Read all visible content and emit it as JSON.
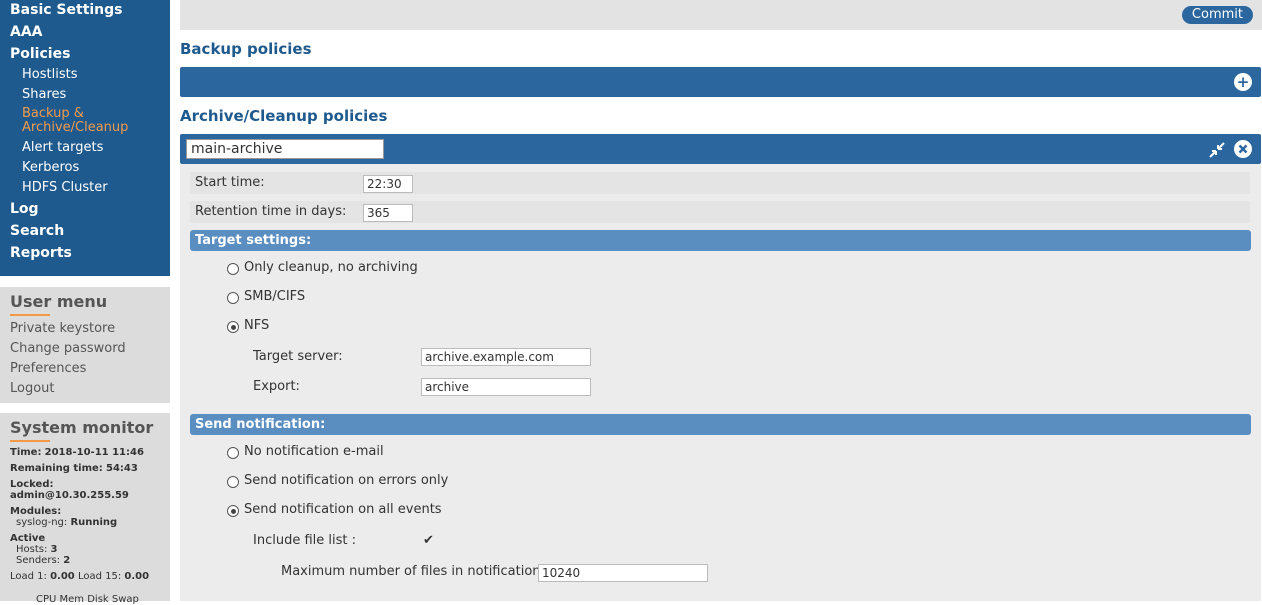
{
  "nav": {
    "top_items": [
      "Basic Settings",
      "AAA",
      "Policies"
    ],
    "sub_items": [
      "Hostlists",
      "Shares",
      "Backup &",
      "Archive/Cleanup",
      "Alert targets",
      "Kerberos",
      "HDFS Cluster"
    ],
    "bottom_items": [
      "Log",
      "Search",
      "Reports"
    ]
  },
  "user_menu": {
    "title": "User menu",
    "items": [
      "Private keystore",
      "Change password",
      "Preferences",
      "Logout"
    ]
  },
  "system_monitor": {
    "title": "System monitor",
    "time_label": "Time:",
    "time_value": "2018-10-11 11:46",
    "remaining_label": "Remaining time:",
    "remaining_value": "54:43",
    "locked_label": "Locked:",
    "locked_value": "admin@10.30.255.59",
    "modules_label": "Modules:",
    "module_name": "syslog-ng:",
    "module_status": "Running",
    "active_label": "Active",
    "hosts_label": "Hosts:",
    "hosts_value": "3",
    "senders_label": "Senders:",
    "senders_value": "2",
    "load1_label": "Load 1:",
    "load1_value": "0.00",
    "load15_label": "Load 15:",
    "load15_value": "0.00",
    "cols": "CPU  Mem Disk  Swap"
  },
  "toolbar": {
    "commit_label": "Commit"
  },
  "backup": {
    "title": "Backup policies",
    "add_icon": "+"
  },
  "archive": {
    "title": "Archive/Cleanup policies",
    "policy_name": "main-archive",
    "start_time_label": "Start time:",
    "start_time_value": "22:30",
    "retention_label": "Retention time in days:",
    "retention_value": "365",
    "target_section": "Target settings:",
    "target_options": [
      "Only cleanup, no archiving",
      "SMB/CIFS",
      "NFS"
    ],
    "target_selected": 2,
    "target_server_label": "Target server:",
    "target_server_value": "archive.example.com",
    "export_label": "Export:",
    "export_value": "archive",
    "notify_section": "Send notification:",
    "notify_options": [
      "No notification e-mail",
      "Send notification on errors only",
      "Send notification on all events"
    ],
    "notify_selected": 2,
    "include_file_list_label": "Include file list :",
    "include_file_list_checked": "✔",
    "max_files_label": "Maximum number of files in notification:",
    "max_files_value": "10240"
  },
  "colors": {
    "accent": "#1e5a8e",
    "highlight": "#f39a4a",
    "section": "#5b8ec0"
  }
}
